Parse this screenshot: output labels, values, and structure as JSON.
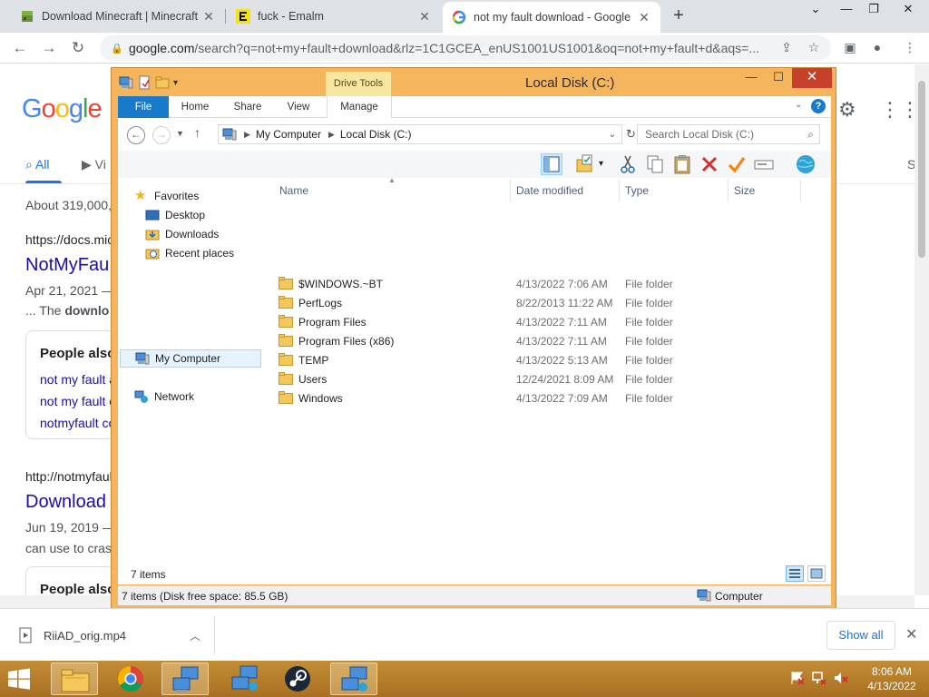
{
  "browser": {
    "tabs": [
      {
        "title": "Download Minecraft | Minecraft",
        "close": "✕"
      },
      {
        "title": "fuck - Emalm",
        "close": "✕"
      },
      {
        "title": "not my fault download - Google",
        "close": "✕"
      }
    ],
    "new_tab": "+",
    "url_host": "google.com",
    "url_rest": "/search?q=not+my+fault+download&rlz=1C1GCEA_enUS1001US1001&oq=not+my+fault+d&aqs=..."
  },
  "google": {
    "tabs": {
      "all": "All",
      "videos": "Vi",
      "right": "S"
    },
    "about": "About 319,000,",
    "results": [
      {
        "url": "https://docs.mic",
        "title": "NotMyFau",
        "date": "Apr 21, 2021 —",
        "snippet_pre": "... The ",
        "snippet_bold": "downlo"
      },
      {
        "url": "http://notmyfaul",
        "title": "Download",
        "date": "Jun 19, 2019 —",
        "snippet": "can use to cras"
      }
    ],
    "people_also": "People also",
    "people_items": [
      "not my fault a",
      "not my fault c",
      "notmyfault co"
    ],
    "people_also_2": "People also"
  },
  "explorer": {
    "title": "Local Disk (C:)",
    "drive_tools": "Drive Tools",
    "ribbon_tabs": {
      "file": "File",
      "home": "Home",
      "share": "Share",
      "view": "View",
      "manage": "Manage"
    },
    "breadcrumb": [
      "My Computer",
      "Local Disk (C:)"
    ],
    "search_placeholder": "Search Local Disk (C:)",
    "nav": {
      "favorites": "Favorites",
      "desktop": "Desktop",
      "downloads": "Downloads",
      "recent": "Recent places",
      "computer": "My Computer",
      "network": "Network"
    },
    "columns": {
      "name": "Name",
      "date": "Date modified",
      "type": "Type",
      "size": "Size"
    },
    "files": [
      {
        "name": "$WINDOWS.~BT",
        "date": "4/13/2022 7:06 AM",
        "type": "File folder"
      },
      {
        "name": "PerfLogs",
        "date": "8/22/2013 11:22 AM",
        "type": "File folder"
      },
      {
        "name": "Program Files",
        "date": "4/13/2022 7:11 AM",
        "type": "File folder"
      },
      {
        "name": "Program Files (x86)",
        "date": "4/13/2022 7:11 AM",
        "type": "File folder"
      },
      {
        "name": "TEMP",
        "date": "4/13/2022 5:13 AM",
        "type": "File folder"
      },
      {
        "name": "Users",
        "date": "12/24/2021 8:09 AM",
        "type": "File folder"
      },
      {
        "name": "Windows",
        "date": "4/13/2022 7:09 AM",
        "type": "File folder"
      }
    ],
    "item_count": "7 items",
    "status_detail": "7 items (Disk free space: 85.5 GB)",
    "status_location": "Computer"
  },
  "downloads": {
    "file": "RiiAD_orig.mp4",
    "show_all": "Show all"
  },
  "taskbar": {
    "time": "8:06 AM",
    "date": "4/13/2022"
  },
  "colors": {
    "explorer_frame": "#f4b55d",
    "file_tab": "#1979ca",
    "google_link": "#1a0dab",
    "taskbar": "#b47b2b"
  }
}
